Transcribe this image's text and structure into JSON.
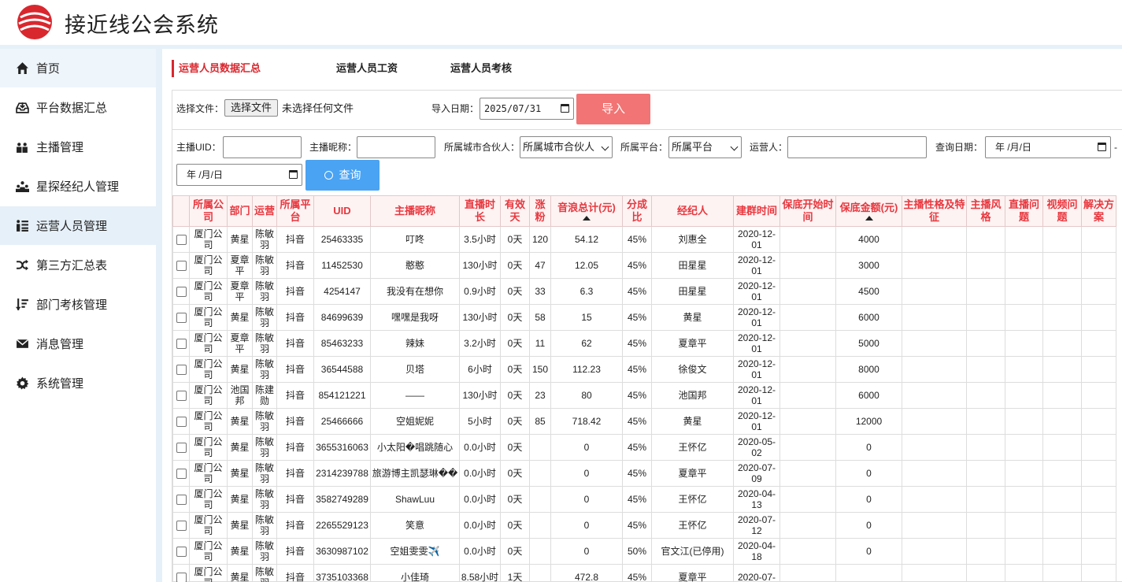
{
  "app": {
    "title": "接近线公会系统"
  },
  "sidebar": {
    "items": [
      {
        "label": "首页",
        "icon": "home-icon"
      },
      {
        "label": "平台数据汇总",
        "icon": "inbox-icon"
      },
      {
        "label": "主播管理",
        "icon": "users-icon"
      },
      {
        "label": "星探经纪人管理",
        "icon": "group-icon"
      },
      {
        "label": "运营人员管理",
        "icon": "list-icon",
        "active": true
      },
      {
        "label": "第三方汇总表",
        "icon": "shuffle-icon"
      },
      {
        "label": "部门考核管理",
        "icon": "sort-icon"
      },
      {
        "label": "消息管理",
        "icon": "envelope-icon"
      },
      {
        "label": "系统管理",
        "icon": "gear-icon"
      }
    ]
  },
  "tabs": [
    {
      "label": "运营人员数据汇总",
      "active": true
    },
    {
      "label": "运营人员工资"
    },
    {
      "label": "运营人员考核"
    }
  ],
  "import": {
    "file_label": "选择文件：",
    "file_button": "选择文件",
    "file_status": "未选择任何文件",
    "date_label": "导入日期：",
    "date_value": "2025/07/31",
    "button": "导入"
  },
  "filters": {
    "uid_label": "主播UID：",
    "nick_label": "主播昵称：",
    "city_label": "所属城市合伙人：",
    "city_value": "所属城市合伙人",
    "platform_label": "所属平台：",
    "platform_value": "所属平台",
    "operator_label": "运营人：",
    "date_label": "查询日期：",
    "date_placeholder": "年 /月/日",
    "date_dash": "-",
    "query_button": "查询"
  },
  "table": {
    "headers": [
      "所属公司",
      "部门",
      "运营",
      "所属平台",
      "UID",
      "主播昵称",
      "直播时长",
      "有效天",
      "涨粉",
      "音浪总计(元)",
      "分成比",
      "经纪人",
      "建群时间",
      "保底开始时间",
      "保底金额(元)",
      "主播性格及特征",
      "主播风格",
      "直播问题",
      "视频问题",
      "解决方案"
    ],
    "rows": [
      [
        "厦门公司",
        "黄星",
        "陈敏羽",
        "抖音",
        "25463335",
        "叮咚",
        "3.5小时",
        "0天",
        "120",
        "54.12",
        "45%",
        "刘惠全",
        "2020-12-01",
        "",
        "4000"
      ],
      [
        "厦门公司",
        "夏章平",
        "陈敏羽",
        "抖音",
        "11452530",
        "憨憨",
        "130小时",
        "0天",
        "47",
        "12.05",
        "45%",
        "田星星",
        "2020-12-01",
        "",
        "3000"
      ],
      [
        "厦门公司",
        "夏章平",
        "陈敏羽",
        "抖音",
        "4254147",
        "我没有在想你",
        "0.9小时",
        "0天",
        "33",
        "6.3",
        "45%",
        "田星星",
        "2020-12-01",
        "",
        "4500"
      ],
      [
        "厦门公司",
        "黄星",
        "陈敏羽",
        "抖音",
        "84699639",
        "嘿嘿是我呀",
        "130小时",
        "0天",
        "58",
        "15",
        "45%",
        "黄星",
        "2020-12-01",
        "",
        "6000"
      ],
      [
        "厦门公司",
        "夏章平",
        "陈敏羽",
        "抖音",
        "85463233",
        "辣妹",
        "3.2小时",
        "0天",
        "11",
        "62",
        "45%",
        "夏章平",
        "2020-12-01",
        "",
        "5000"
      ],
      [
        "厦门公司",
        "黄星",
        "陈敏羽",
        "抖音",
        "36544588",
        "贝塔",
        "6小时",
        "0天",
        "150",
        "112.23",
        "45%",
        "徐俊文",
        "2020-12-01",
        "",
        "8000"
      ],
      [
        "厦门公司",
        "池国邦",
        "陈建勋",
        "抖音",
        "854121221",
        "——",
        "130小时",
        "0天",
        "23",
        "80",
        "45%",
        "池国邦",
        "2020-12-01",
        "",
        "6000"
      ],
      [
        "厦门公司",
        "黄星",
        "陈敏羽",
        "抖音",
        "25466666",
        "空姐妮妮",
        "5小时",
        "0天",
        "85",
        "718.42",
        "45%",
        "黄星",
        "2020-12-01",
        "",
        "12000"
      ],
      [
        "厦门公司",
        "黄星",
        "陈敏羽",
        "抖音",
        "3655316063",
        "小太阳�唱跳随心",
        "0.0小时",
        "0天",
        "",
        "0",
        "45%",
        "王怀亿",
        "2020-05-02",
        "",
        "0"
      ],
      [
        "厦门公司",
        "黄星",
        "陈敏羽",
        "抖音",
        "2314239788",
        "旅游博主凯瑟琳��",
        "0.0小时",
        "0天",
        "",
        "0",
        "45%",
        "夏章平",
        "2020-07-09",
        "",
        "0"
      ],
      [
        "厦门公司",
        "黄星",
        "陈敏羽",
        "抖音",
        "3582749289",
        "ShawLuu",
        "0.0小时",
        "0天",
        "",
        "0",
        "45%",
        "王怀亿",
        "2020-04-13",
        "",
        "0"
      ],
      [
        "厦门公司",
        "黄星",
        "陈敏羽",
        "抖音",
        "2265529123",
        "笑意",
        "0.0小时",
        "0天",
        "",
        "0",
        "45%",
        "王怀亿",
        "2020-07-12",
        "",
        "0"
      ],
      [
        "厦门公司",
        "黄星",
        "陈敏羽",
        "抖音",
        "3630987102",
        "空姐雯雯✈️",
        "0.0小时",
        "0天",
        "",
        "0",
        "50%",
        "官文江(已停用)",
        "2020-04-18",
        "",
        "0"
      ],
      [
        "厦门公司",
        "黄星",
        "陈敏羽",
        "抖音",
        "3735103368",
        "小佳琦",
        "8.58小时",
        "1天",
        "",
        "472.8",
        "45%",
        "夏章平",
        "2020-07-",
        "",
        ""
      ]
    ]
  }
}
